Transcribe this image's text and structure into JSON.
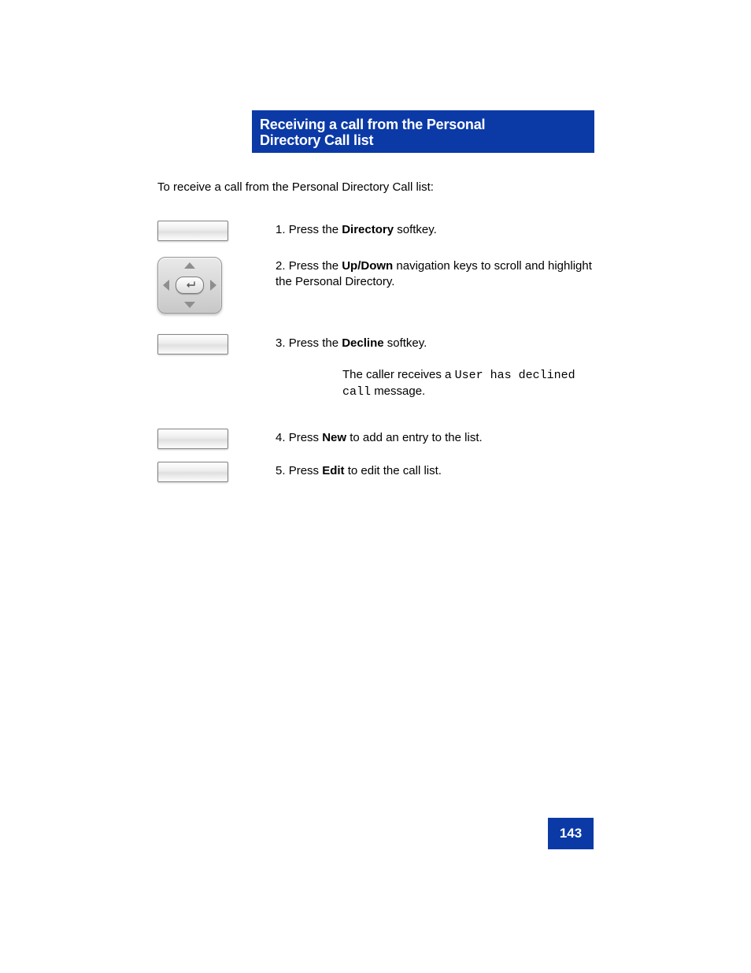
{
  "header": {
    "line1": "Receiving a call from the Personal",
    "line2": "Directory Call list"
  },
  "intro": "To receive a call from the Personal Directory Call list:",
  "steps": {
    "s1": {
      "num": "1.",
      "label": "Directory",
      "text_a": "Press the ",
      "text_b": " softkey."
    },
    "s2": {
      "num": "2.",
      "text_a": "Press the ",
      "label": "Up/Down",
      "text_b": " navigation keys to scroll and highlight the Personal Directory."
    },
    "s3": {
      "num": "3.",
      "text_a": "Press the ",
      "label": "Decline",
      "text_b": " softkey."
    },
    "decline_msg_pre": "The caller receives a ",
    "decline_msg_code": "User has declined call",
    "decline_msg_post": " message.",
    "s4": {
      "num": "4.",
      "text_a": "Press ",
      "label": "New",
      "text_b": " to add an entry to the list."
    },
    "s5": {
      "num": "5.",
      "text_a": "Press ",
      "label": "Edit",
      "text_b": " to edit the call list."
    }
  },
  "icons": {
    "softkey": "softkey-button",
    "nav": "navigation-cluster"
  },
  "page_number": "143"
}
